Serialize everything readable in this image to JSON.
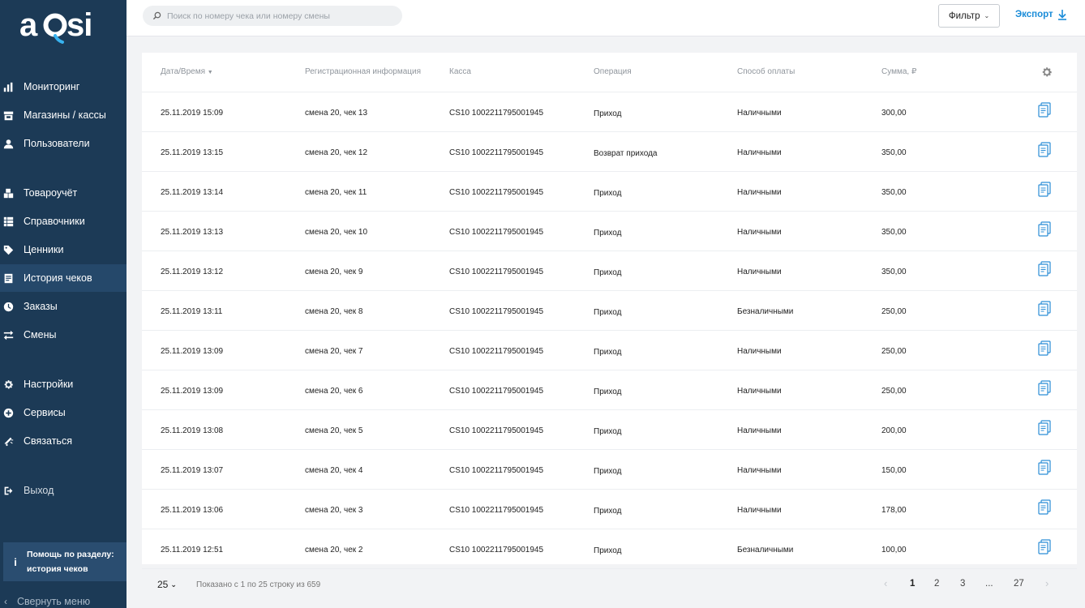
{
  "sidebar": {
    "logo": "aQsi",
    "items": [
      {
        "label": "Мониторинг",
        "icon": "bar-chart-icon"
      },
      {
        "label": "Магазины / кассы",
        "icon": "store-icon"
      },
      {
        "label": "Пользователи",
        "icon": "user-icon"
      },
      {
        "label": "Товароучёт",
        "icon": "boxes-icon"
      },
      {
        "label": "Справочники",
        "icon": "list-icon"
      },
      {
        "label": "Ценники",
        "icon": "tag-icon"
      },
      {
        "label": "История чеков",
        "icon": "receipt-history-icon",
        "active": true
      },
      {
        "label": "Заказы",
        "icon": "clock-icon"
      },
      {
        "label": "Смены",
        "icon": "swap-icon"
      },
      {
        "label": "Настройки",
        "icon": "gear-icon"
      },
      {
        "label": "Сервисы",
        "icon": "plus-circle-icon"
      },
      {
        "label": "Связаться",
        "icon": "megaphone-icon"
      }
    ],
    "exit_label": "Выход",
    "help_line1": "Помощь по разделу:",
    "help_line2": "история чеков",
    "collapse_label": "Свернуть меню"
  },
  "topbar": {
    "search_placeholder": "Поиск по номеру чека или номеру смены",
    "filter_label": "Фильтр",
    "export_label": "Экспорт"
  },
  "table": {
    "columns": {
      "datetime": "Дата/Время",
      "reg_info": "Регистрационная информация",
      "register": "Касса",
      "operation": "Операция",
      "payment": "Способ оплаты",
      "sum": "Сумма, ₽"
    },
    "rows": [
      {
        "datetime": "25.11.2019 15:09",
        "reg": "смена 20, чек 13",
        "register": "CS10 1002211795001945",
        "op": "Приход",
        "pay": "Наличными",
        "sum": "300,00"
      },
      {
        "datetime": "25.11.2019 13:15",
        "reg": "смена 20, чек 12",
        "register": "CS10 1002211795001945",
        "op": "Возврат прихода",
        "pay": "Наличными",
        "sum": "350,00"
      },
      {
        "datetime": "25.11.2019 13:14",
        "reg": "смена 20, чек 11",
        "register": "CS10 1002211795001945",
        "op": "Приход",
        "pay": "Наличными",
        "sum": "350,00"
      },
      {
        "datetime": "25.11.2019 13:13",
        "reg": "смена 20, чек 10",
        "register": "CS10 1002211795001945",
        "op": "Приход",
        "pay": "Наличными",
        "sum": "350,00"
      },
      {
        "datetime": "25.11.2019 13:12",
        "reg": "смена 20, чек 9",
        "register": "CS10 1002211795001945",
        "op": "Приход",
        "pay": "Наличными",
        "sum": "350,00"
      },
      {
        "datetime": "25.11.2019 13:11",
        "reg": "смена 20, чек 8",
        "register": "CS10 1002211795001945",
        "op": "Приход",
        "pay": "Безналичными",
        "sum": "250,00"
      },
      {
        "datetime": "25.11.2019 13:09",
        "reg": "смена 20, чек 7",
        "register": "CS10 1002211795001945",
        "op": "Приход",
        "pay": "Наличными",
        "sum": "250,00"
      },
      {
        "datetime": "25.11.2019 13:09",
        "reg": "смена 20, чек 6",
        "register": "CS10 1002211795001945",
        "op": "Приход",
        "pay": "Наличными",
        "sum": "250,00"
      },
      {
        "datetime": "25.11.2019 13:08",
        "reg": "смена 20, чек 5",
        "register": "CS10 1002211795001945",
        "op": "Приход",
        "pay": "Наличными",
        "sum": "200,00"
      },
      {
        "datetime": "25.11.2019 13:07",
        "reg": "смена 20, чек 4",
        "register": "CS10 1002211795001945",
        "op": "Приход",
        "pay": "Наличными",
        "sum": "150,00"
      },
      {
        "datetime": "25.11.2019 13:06",
        "reg": "смена 20, чек 3",
        "register": "CS10 1002211795001945",
        "op": "Приход",
        "pay": "Наличными",
        "sum": "178,00"
      },
      {
        "datetime": "25.11.2019 12:51",
        "reg": "смена 20, чек 2",
        "register": "CS10 1002211795001945",
        "op": "Приход",
        "pay": "Безналичными",
        "sum": "100,00"
      }
    ]
  },
  "footer": {
    "page_size": "25",
    "shown_text": "Показано с 1 по 25 строку из 659",
    "pages": [
      "1",
      "2",
      "3",
      "...",
      "27"
    ],
    "current_page": "1"
  },
  "colors": {
    "sidebar_bg": "#1c3a56",
    "sidebar_active": "#25486a",
    "accent": "#1a8cd8"
  }
}
